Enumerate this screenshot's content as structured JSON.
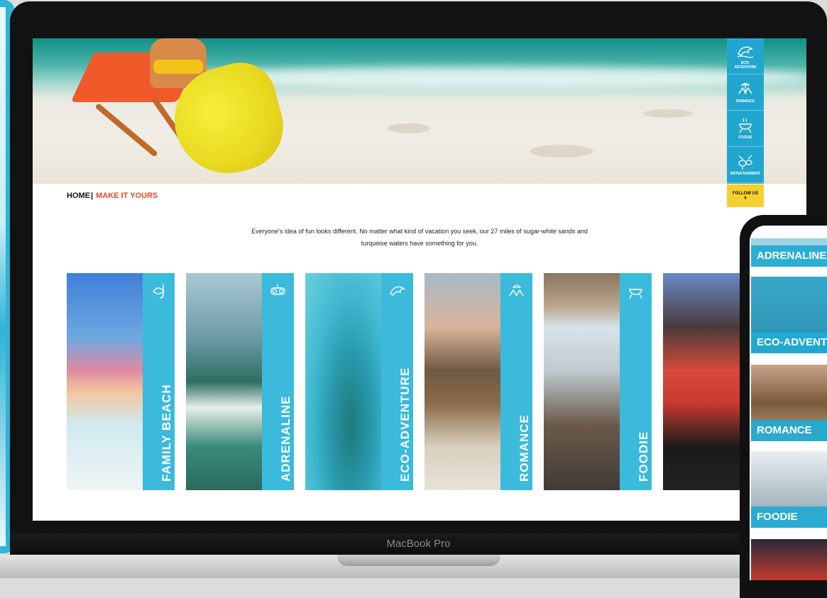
{
  "laptop": {
    "brand_label": "MacBook Pro"
  },
  "side_nav": {
    "items": [
      {
        "label": "ECO-\nADVENTURE",
        "icon": "dolphin-icon"
      },
      {
        "label": "ROMANCE",
        "icon": "beach-chairs-icon"
      },
      {
        "label": "FOODIE",
        "icon": "grill-icon"
      },
      {
        "label": "ENTERTAINMENT",
        "icon": "drums-icon"
      }
    ],
    "follow_label": "FOLLOW US",
    "follow_arrow": "▾"
  },
  "breadcrumb": {
    "home": "HOME",
    "separator": "|",
    "current": "MAKE IT YOURS"
  },
  "intro_text": "Everyone's idea of fun looks different. No matter what kind of vacation you seek, our 27 miles of sugar-white sands and turquoise waters have something for you.",
  "categories": [
    {
      "label": "FAMILY BEACH",
      "icon": "snorkel-icon"
    },
    {
      "label": "ADRENALINE",
      "icon": "dive-mask-icon"
    },
    {
      "label": "ECO-ADVENTURE",
      "icon": "dolphin-icon"
    },
    {
      "label": "ROMANCE",
      "icon": "beach-chairs-icon"
    },
    {
      "label": "FOODIE",
      "icon": "grill-icon"
    }
  ],
  "mobile": {
    "items": [
      {
        "label": "ADRENALINE"
      },
      {
        "label": "ECO-ADVENTURE"
      },
      {
        "label": "ROMANCE"
      },
      {
        "label": "FOODIE"
      }
    ]
  },
  "colors": {
    "accent_blue": "#21a6cf",
    "accent_red": "#e04a2a",
    "follow_yellow": "#f4cf30"
  }
}
